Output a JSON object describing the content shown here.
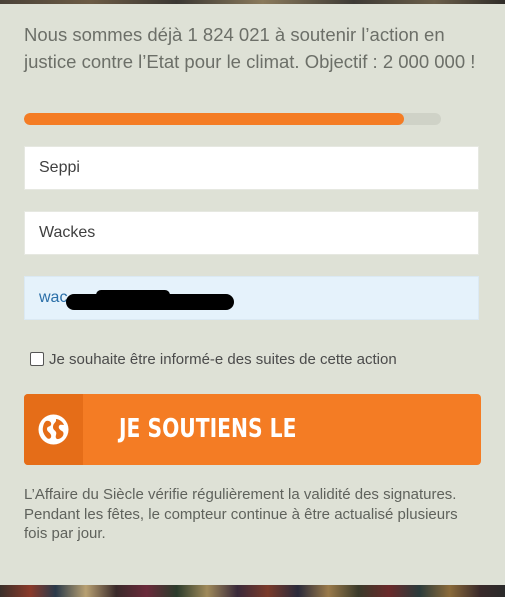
{
  "intro_text": "Nous sommes déjà 1 824 021 à soutenir l’action en justice contre l’Etat pour le climat. Objectif : 2 000 000 !",
  "progress": {
    "current": 1824021,
    "goal": 2000000,
    "fraction": 0.912,
    "color": "#f47c24"
  },
  "form": {
    "first_name_value": "Seppi",
    "last_name_value": "Wackes",
    "email_value_visible": "wac",
    "email_redacted": true,
    "newsletter_checkbox": {
      "checked": false,
      "label": "Je souhaite être informé-e des suites de cette action"
    }
  },
  "submit": {
    "label": "JE SOUTIENS LE RECOURS",
    "icon": "globe-icon",
    "color": "#f47c24"
  },
  "footnote": "L’Affaire du Siècle vérifie régulièrement la validité des signatures. Pendant les fêtes, le compteur continue à être actualisé plusieurs fois par jour."
}
